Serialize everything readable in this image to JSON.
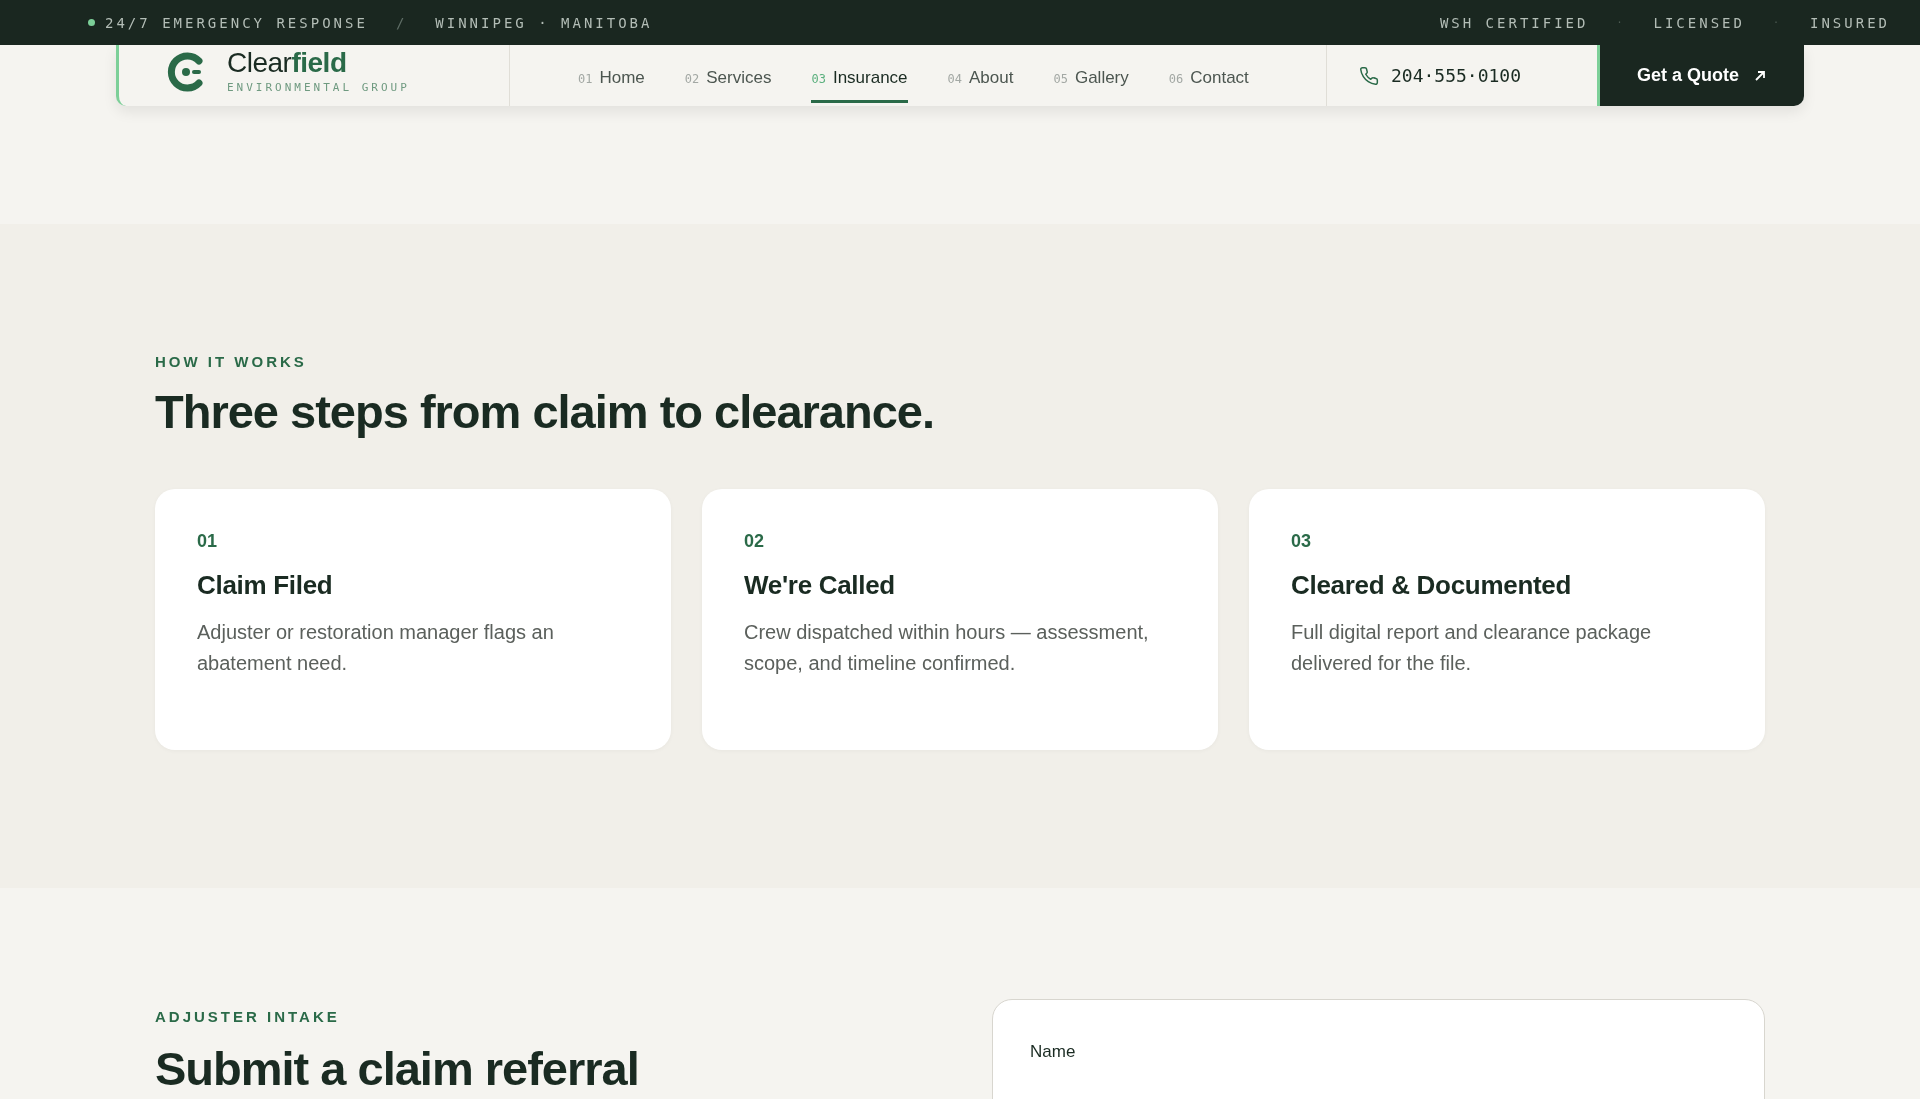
{
  "top_bar": {
    "status": "24/7 EMERGENCY RESPONSE",
    "separator": "/",
    "location": "WINNIPEG · MANITOBA",
    "badges": [
      "WSH CERTIFIED",
      "LICENSED",
      "INSURED"
    ],
    "badge_separator": "·"
  },
  "header": {
    "logo": {
      "name_light": "Clear",
      "name_bold": "field",
      "tagline": "ENVIRONMENTAL GROUP"
    },
    "nav": [
      {
        "number": "01",
        "label": "Home",
        "selected": false
      },
      {
        "number": "02",
        "label": "Services",
        "selected": false
      },
      {
        "number": "03",
        "label": "Insurance",
        "selected": true
      },
      {
        "number": "04",
        "label": "About",
        "selected": false
      },
      {
        "number": "05",
        "label": "Gallery",
        "selected": false
      },
      {
        "number": "06",
        "label": "Contact",
        "selected": false
      }
    ],
    "phone": "204·555·0100",
    "cta": "Get a Quote"
  },
  "how_it_works": {
    "eyebrow": "HOW IT WORKS",
    "title": "Three steps from claim to clearance.",
    "steps": [
      {
        "number": "01",
        "title": "Claim Filed",
        "description": "Adjuster or restoration manager flags an abatement need."
      },
      {
        "number": "02",
        "title": "We're Called",
        "description": "Crew dispatched within hours — assessment, scope, and timeline confirmed."
      },
      {
        "number": "03",
        "title": "Cleared & Documented",
        "description": "Full digital report and clearance package delivered for the file."
      }
    ]
  },
  "intake": {
    "eyebrow": "ADJUSTER INTAKE",
    "title": "Submit a claim referral",
    "form": {
      "fields": [
        {
          "label": "Name"
        }
      ]
    }
  }
}
